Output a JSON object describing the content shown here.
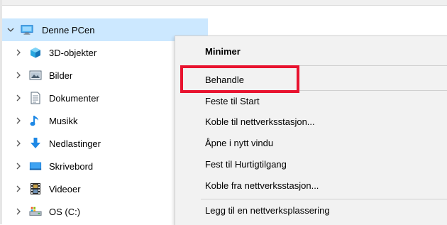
{
  "tree": {
    "root": {
      "label": "Denne PCen",
      "icon": "monitor-icon"
    },
    "items": [
      {
        "label": "3D-objekter",
        "icon": "3d-objects-icon"
      },
      {
        "label": "Bilder",
        "icon": "pictures-icon"
      },
      {
        "label": "Dokumenter",
        "icon": "documents-icon"
      },
      {
        "label": "Musikk",
        "icon": "music-icon"
      },
      {
        "label": "Nedlastinger",
        "icon": "downloads-icon"
      },
      {
        "label": "Skrivebord",
        "icon": "desktop-icon"
      },
      {
        "label": "Videoer",
        "icon": "videos-icon"
      },
      {
        "label": "OS (C:)",
        "icon": "drive-icon"
      }
    ]
  },
  "context_menu": {
    "items": [
      {
        "label": "Minimer"
      },
      {
        "label": "Behandle"
      },
      {
        "label": "Feste til Start"
      },
      {
        "label": "Koble til nettverksstasjon..."
      },
      {
        "label": "Åpne i nytt vindu"
      },
      {
        "label": "Fest til Hurtigtilgang"
      },
      {
        "label": "Koble fra nettverksstasjon..."
      },
      {
        "label": "Legg til en nettverksplassering"
      }
    ]
  },
  "colors": {
    "selection": "#cce8ff",
    "menu_background": "#f2f2f2",
    "highlight": "#e8132f",
    "folder_blue": "#1e88e5"
  }
}
